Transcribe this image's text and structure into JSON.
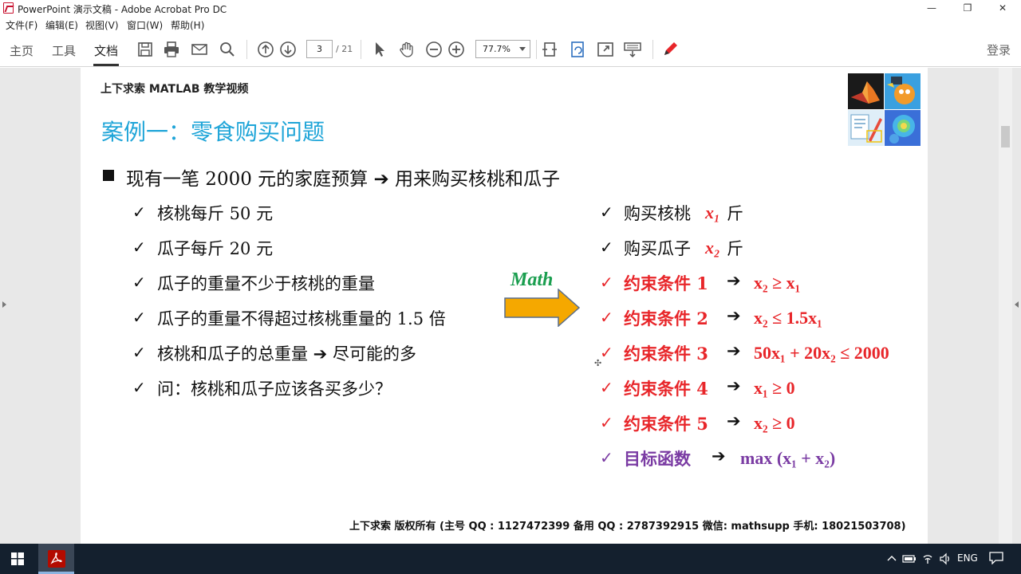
{
  "window": {
    "title": "PowerPoint 演示文稿 - Adobe Acrobat Pro DC",
    "controls": {
      "minimize": "—",
      "restore": "❐",
      "close": "✕"
    }
  },
  "menu": [
    "文件(F)",
    "编辑(E)",
    "视图(V)",
    "窗口(W)",
    "帮助(H)"
  ],
  "toolbar": {
    "tabs": [
      "主页",
      "工具",
      "文档"
    ],
    "active_tab": "文档",
    "page_current": "3",
    "page_total": "/ 21",
    "zoom": "77.7%",
    "login": "登录",
    "icons": [
      "save-icon",
      "print-icon",
      "mail-icon",
      "search-icon",
      "page-up-icon",
      "page-down-icon",
      "select-cursor-icon",
      "hand-tool-icon",
      "zoom-out-icon",
      "zoom-in-icon",
      "fit-page-icon",
      "rotate-icon",
      "fullscreen-icon",
      "keyboard-icon",
      "pen-icon"
    ]
  },
  "slide": {
    "header": "上下求索 MATLAB 教学视频",
    "title": "案例一：零食购买问题",
    "main_line": "现有一笔 2000 元的家庭预算  ➔  用来购买核桃和瓜子",
    "left_items": [
      "核桃每斤 50 元",
      "瓜子每斤 20 元",
      "瓜子的重量不少于核桃的重量",
      "瓜子的重量不得超过核桃重量的 1.5 倍",
      "核桃和瓜子的总重量  ➔  尽可能的多",
      "问：核桃和瓜子应该各买多少？"
    ],
    "check": "✓",
    "arrow_label": "Math",
    "right_items": [
      {
        "label": "购买核桃",
        "formula": "x₁",
        "suffix": "斤",
        "color": "black"
      },
      {
        "label": "购买瓜子",
        "formula": "x₂",
        "suffix": "斤",
        "color": "black"
      },
      {
        "label": "约束条件 1",
        "formula": "x₂ ≥ x₁",
        "suffix": "",
        "color": "red"
      },
      {
        "label": "约束条件 2",
        "formula": "x₂ ≤ 1.5x₁",
        "suffix": "",
        "color": "red"
      },
      {
        "label": "约束条件 3",
        "formula": "50x₁ + 20x₂ ≤ 2000",
        "suffix": "",
        "color": "red"
      },
      {
        "label": "约束条件 4",
        "formula": "x₁ ≥ 0",
        "suffix": "",
        "color": "red"
      },
      {
        "label": "约束条件 5",
        "formula": "x₂ ≥ 0",
        "suffix": "",
        "color": "red"
      },
      {
        "label": "目标函数",
        "formula": "max (x₁ + x₂)",
        "suffix": "",
        "color": "purple"
      }
    ],
    "arrow_sep": "➔",
    "footer": "上下求索  版权所有  (主号 QQ : 1127472399   备用 QQ : 2787392915   微信: mathsupp   手机: 18021503708)"
  },
  "taskbar": {
    "lang": "ENG"
  },
  "colors": {
    "title_blue": "#1fa5d8",
    "constraint_red": "#e8262a",
    "objective_purple": "#7a3ba3",
    "math_green": "#1a9e4f",
    "arrow_fill": "#f5a800"
  }
}
